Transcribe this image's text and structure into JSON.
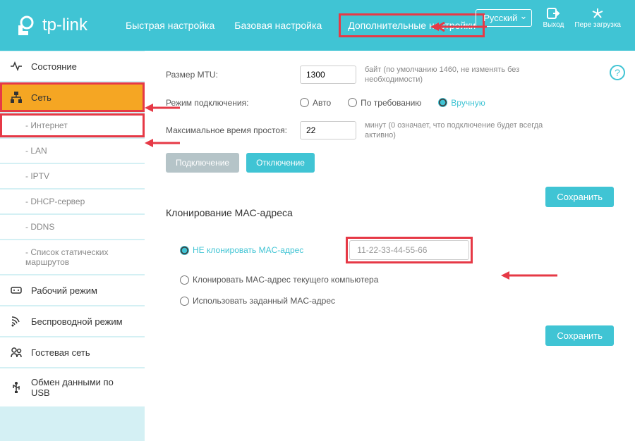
{
  "brand": "tp-link",
  "header": {
    "tabs": [
      "Быстрая настройка",
      "Базовая настройка",
      "Дополнительные настройки"
    ],
    "lang": "Русский",
    "exit": "Выход",
    "reload": "Пере загрузка"
  },
  "sidebar": {
    "status": "Состояние",
    "network": "Сеть",
    "subs": {
      "internet": "- Интернет",
      "lan": "- LAN",
      "iptv": "- IPTV",
      "dhcp": "- DHCP-сервер",
      "ddns": "- DDNS",
      "routes": "- Список статических маршрутов"
    },
    "mode": "Рабочий режим",
    "wireless": "Беспроводной режим",
    "guest": "Гостевая сеть",
    "usb": "Обмен данными по USB"
  },
  "content": {
    "mtu_label": "Размер MTU:",
    "mtu_value": "1300",
    "mtu_hint": "байт (по умолчанию 1460, не изменять без необходимости)",
    "conn_mode_label": "Режим подключения:",
    "conn_auto": "Авто",
    "conn_demand": "По требованию",
    "conn_manual": "Вручную",
    "idle_label": "Максимальное время простоя:",
    "idle_value": "22",
    "idle_hint": "минут (0 означает, что подключение будет всегда активно)",
    "connect": "Подключение",
    "disconnect": "Отключение",
    "save": "Сохранить",
    "mac_title": "Клонирование MAC-адреса",
    "mac_no_clone": "НЕ клонировать MAC-адрес",
    "mac_value": "11-22-33-44-55-66",
    "mac_clone_pc": "Клонировать MAC-адрес текущего компьютера",
    "mac_custom": "Использовать заданный MAC-адрес"
  }
}
